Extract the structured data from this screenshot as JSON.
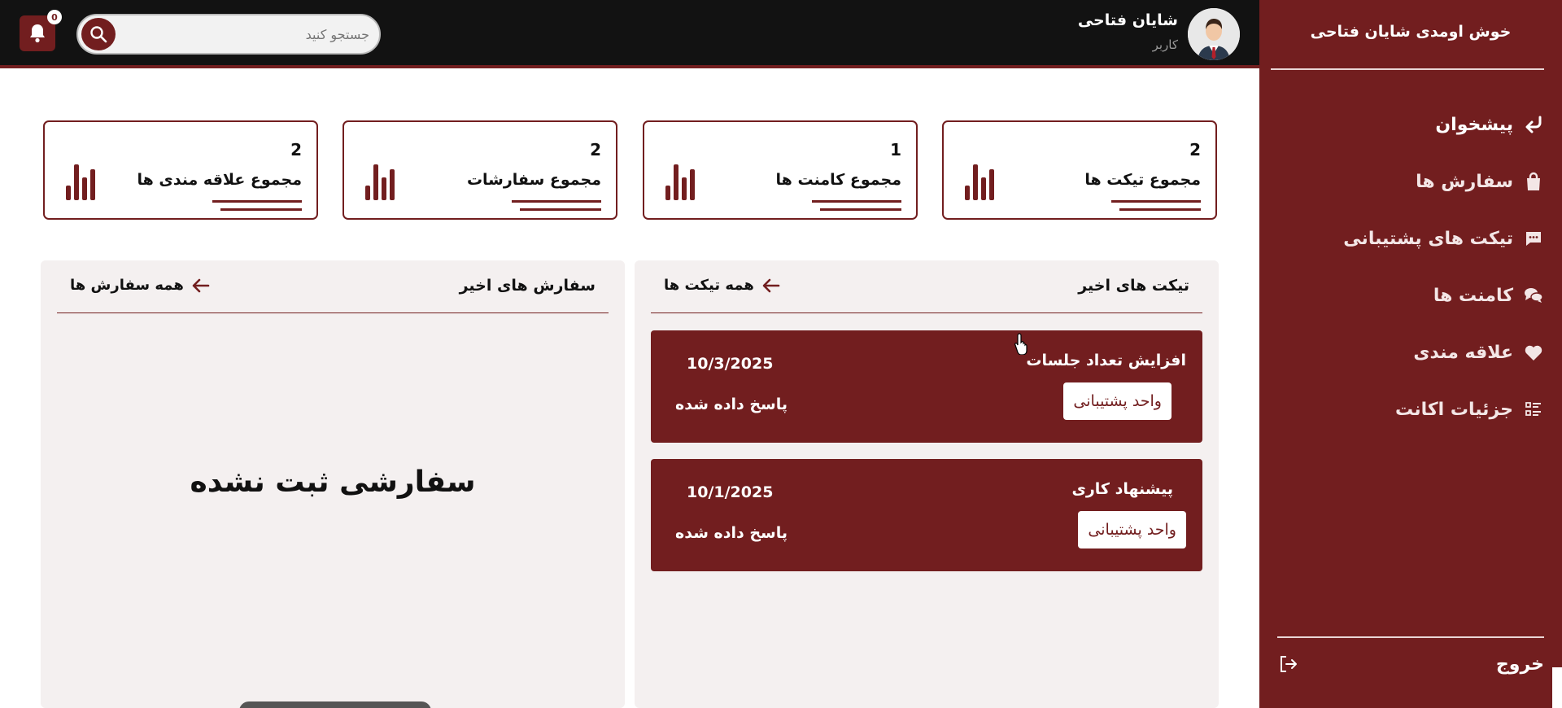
{
  "sidebar": {
    "welcome": "خوش اومدی شایان فتاحی",
    "items": [
      {
        "label": "پیشخوان",
        "icon": "return-arrow-icon"
      },
      {
        "label": "سفارش ها",
        "icon": "shopping-bag-icon"
      },
      {
        "label": "تیکت های پشتیبانی",
        "icon": "message-icon"
      },
      {
        "label": "کامنت ها",
        "icon": "comments-icon"
      },
      {
        "label": "علاقه مندی",
        "icon": "heart-icon"
      },
      {
        "label": "جزئیات اکانت",
        "icon": "list-details-icon"
      }
    ],
    "logout_label": "خروج"
  },
  "header": {
    "notification_count": "0",
    "search_placeholder": "جستجو کنید",
    "user_name": "شایان فتاحی",
    "user_role": "کاربر"
  },
  "stats": [
    {
      "count": "2",
      "label": "مجموع تیکت ها"
    },
    {
      "count": "1",
      "label": "مجموع کامنت ها"
    },
    {
      "count": "2",
      "label": "مجموع سفارشات"
    },
    {
      "count": "2",
      "label": "مجموع علاقه مندی ها"
    }
  ],
  "tickets_panel": {
    "title": "تیکت های اخیر",
    "link": "همه تیکت ها",
    "tickets": [
      {
        "title": "افزایش تعداد جلسات",
        "department": "واحد پشتیبانی",
        "date": "10/3/2025",
        "status": "پاسخ داده شده"
      },
      {
        "title": "پیشنهاد کاری",
        "department": "واحد پشتیبانی",
        "date": "10/1/2025",
        "status": "پاسخ داده شده"
      }
    ]
  },
  "orders_panel": {
    "title": "سفارش های اخیر",
    "link": "همه سفارش ها",
    "empty_message": "سفارشی ثبت نشده"
  },
  "colors": {
    "brand": "#721e1f",
    "topbar": "#121212",
    "panel_bg": "#f4f0f0"
  }
}
